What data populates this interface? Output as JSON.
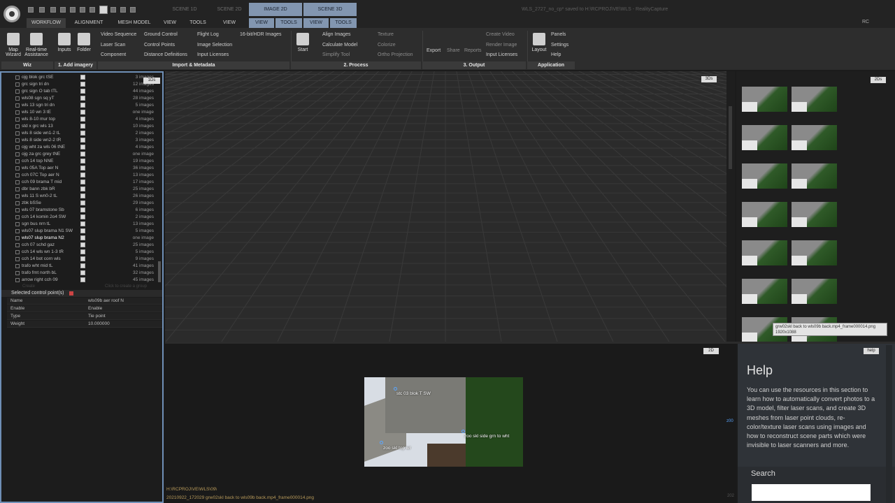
{
  "window": {
    "title": "WLS_2727_no_cp* saved to H:\\RCPROJ\\VE\\WLS - RealityCapture",
    "rc": "RC"
  },
  "scene_tabs": [
    {
      "label": "SCENE 1D",
      "active": false
    },
    {
      "label": "SCENE 2D",
      "active": false
    },
    {
      "label": "IMAGE 2D",
      "active": true
    },
    {
      "label": "SCENE 3D",
      "active": true
    }
  ],
  "ribbon_tabs": [
    "WORKFLOW",
    "ALIGNMENT",
    "MESH MODEL",
    "TOOLS",
    "VIEW"
  ],
  "sub_tabs": [
    "VIEW",
    "TOOLS",
    "VIEW",
    "TOOLS"
  ],
  "ribbon": {
    "map_wizard": "Map Wizard",
    "realtime": "Real-time Assistance",
    "inputs": "Inputs",
    "folder": "Folder",
    "import_col1": [
      "Video Sequence",
      "Laser Scan",
      "Component"
    ],
    "import_col2": [
      "Ground Control",
      "Control Points",
      "Distance Definitions"
    ],
    "import_col3": [
      "Flight Log",
      "Image Selection",
      "Input Licenses"
    ],
    "import_col4": "16-bit/HDR Images",
    "start": "Start",
    "process_col1": [
      "Align Images",
      "Calculate Model",
      "Simplify Tool"
    ],
    "process_col2": [
      "Texture",
      "Colorize",
      "Ortho Projection"
    ],
    "export": "Export",
    "share": "Share",
    "reports": "Reports",
    "output_col": [
      "Create Video",
      "Render Image",
      "Input Licenses"
    ],
    "layout": "Layout",
    "app_col": [
      "Panels",
      "Settings",
      "Help"
    ],
    "groups": [
      "Wiz",
      "1. Add imagery",
      "Import & Metadata",
      "2. Process",
      "3. Output",
      "Application"
    ]
  },
  "tree": {
    "badge": "1Ds",
    "rows": [
      {
        "name": "ojg blok grc tSE",
        "count": "3 images"
      },
      {
        "name": "grc sign tri dn",
        "count": "12 images"
      },
      {
        "name": "grc sign O tab tTL",
        "count": "44 images"
      },
      {
        "name": "wls08 sgn sq yT",
        "count": "28 images"
      },
      {
        "name": "wls 13 sgn tri dn",
        "count": "5 images"
      },
      {
        "name": "wls 10 wn 3 tE",
        "count": "one image"
      },
      {
        "name": "wls 8-10 mur top",
        "count": "4 images"
      },
      {
        "name": "std x grc wls 13",
        "count": "10 images"
      },
      {
        "name": "wls 8 side wn1-2 tL",
        "count": "2 images"
      },
      {
        "name": "wls 8 side wn2-2 tR",
        "count": "3 images"
      },
      {
        "name": "ojg wht za wls 06 tNE",
        "count": "4 images"
      },
      {
        "name": "ojg za grc grey tNE",
        "count": "one image"
      },
      {
        "name": "cch 14 top NNE",
        "count": "19 images"
      },
      {
        "name": "wls 05A Top aer N",
        "count": "36 images"
      },
      {
        "name": "cch 07C Top aer N",
        "count": "13 images"
      },
      {
        "name": "cch 09 brama T mid",
        "count": "17 images"
      },
      {
        "name": "dbr bann zbk bR",
        "count": "25 images"
      },
      {
        "name": "wls 11 S wn0-2 tL",
        "count": "26 images"
      },
      {
        "name": "zbk bSSe",
        "count": "29 images"
      },
      {
        "name": "wls 07 bramstone Sb",
        "count": "6 images"
      },
      {
        "name": "cch 14 komin 2o4 SW",
        "count": "2 images"
      },
      {
        "name": "sgn bus nrn tL",
        "count": "13 images"
      },
      {
        "name": "wls07 slup brama N1 SW",
        "count": "5 images"
      },
      {
        "name": "wls07 slup brama N2",
        "count": "one image"
      },
      {
        "name": "cch 07 schd gaz",
        "count": "25 images"
      },
      {
        "name": "cch 14 wls wn 1-3 tR",
        "count": "5 images"
      },
      {
        "name": "cch 14 bot corn wls",
        "count": "9 images"
      },
      {
        "name": "trafo wht mid tL",
        "count": "41 images"
      },
      {
        "name": "trafo frnt north bL",
        "count": "32 images"
      },
      {
        "name": "arrow right cch 09",
        "count": "45 images"
      }
    ],
    "ghost_left": "Create",
    "ghost_right": "Click to create a group"
  },
  "props": {
    "header": "Selected control point(s)",
    "rows": [
      {
        "key": "Name",
        "value": "wls09b aer roof N"
      },
      {
        "key": "Enable",
        "value": "Enable"
      },
      {
        "key": "Type",
        "value": "Tie point"
      },
      {
        "key": "Weight",
        "value": "10.000000"
      }
    ]
  },
  "viewport3d": {
    "badge": "3Ds"
  },
  "right_panel": {
    "badge": "2Ds",
    "tooltip_line1": "grw02skl back to wls09b back.mp4_frame000014.png",
    "tooltip_line2": "1920x1088"
  },
  "viewport2d": {
    "badge": "2D",
    "cp1": "stc 03 blok T SW",
    "cp2": "zoo skl side grn to wht",
    "cp3": "zoo skl top wr",
    "path_line1": "H:\\RCPROJ\\VE\\WLS\\09\\",
    "path_line2": "20210922_172029 grw02skl back to wls09b back.mp4_frame000014.png",
    "zoom_label": "z00",
    "footer": "202"
  },
  "help": {
    "badge": "help",
    "title": "Help",
    "body": "You can use the resources in this section to learn how to automatically convert photos to a 3D model, filter laser scans, and create 3D meshes from laser point clouds, re-color/texture laser scans using images and how to reconstruct scene parts which were invisible to laser scanners and more.",
    "search_label": "Search",
    "search_value": ""
  },
  "colors": {
    "accent": "#8296b0",
    "panel_border": "#6f8fb6"
  }
}
